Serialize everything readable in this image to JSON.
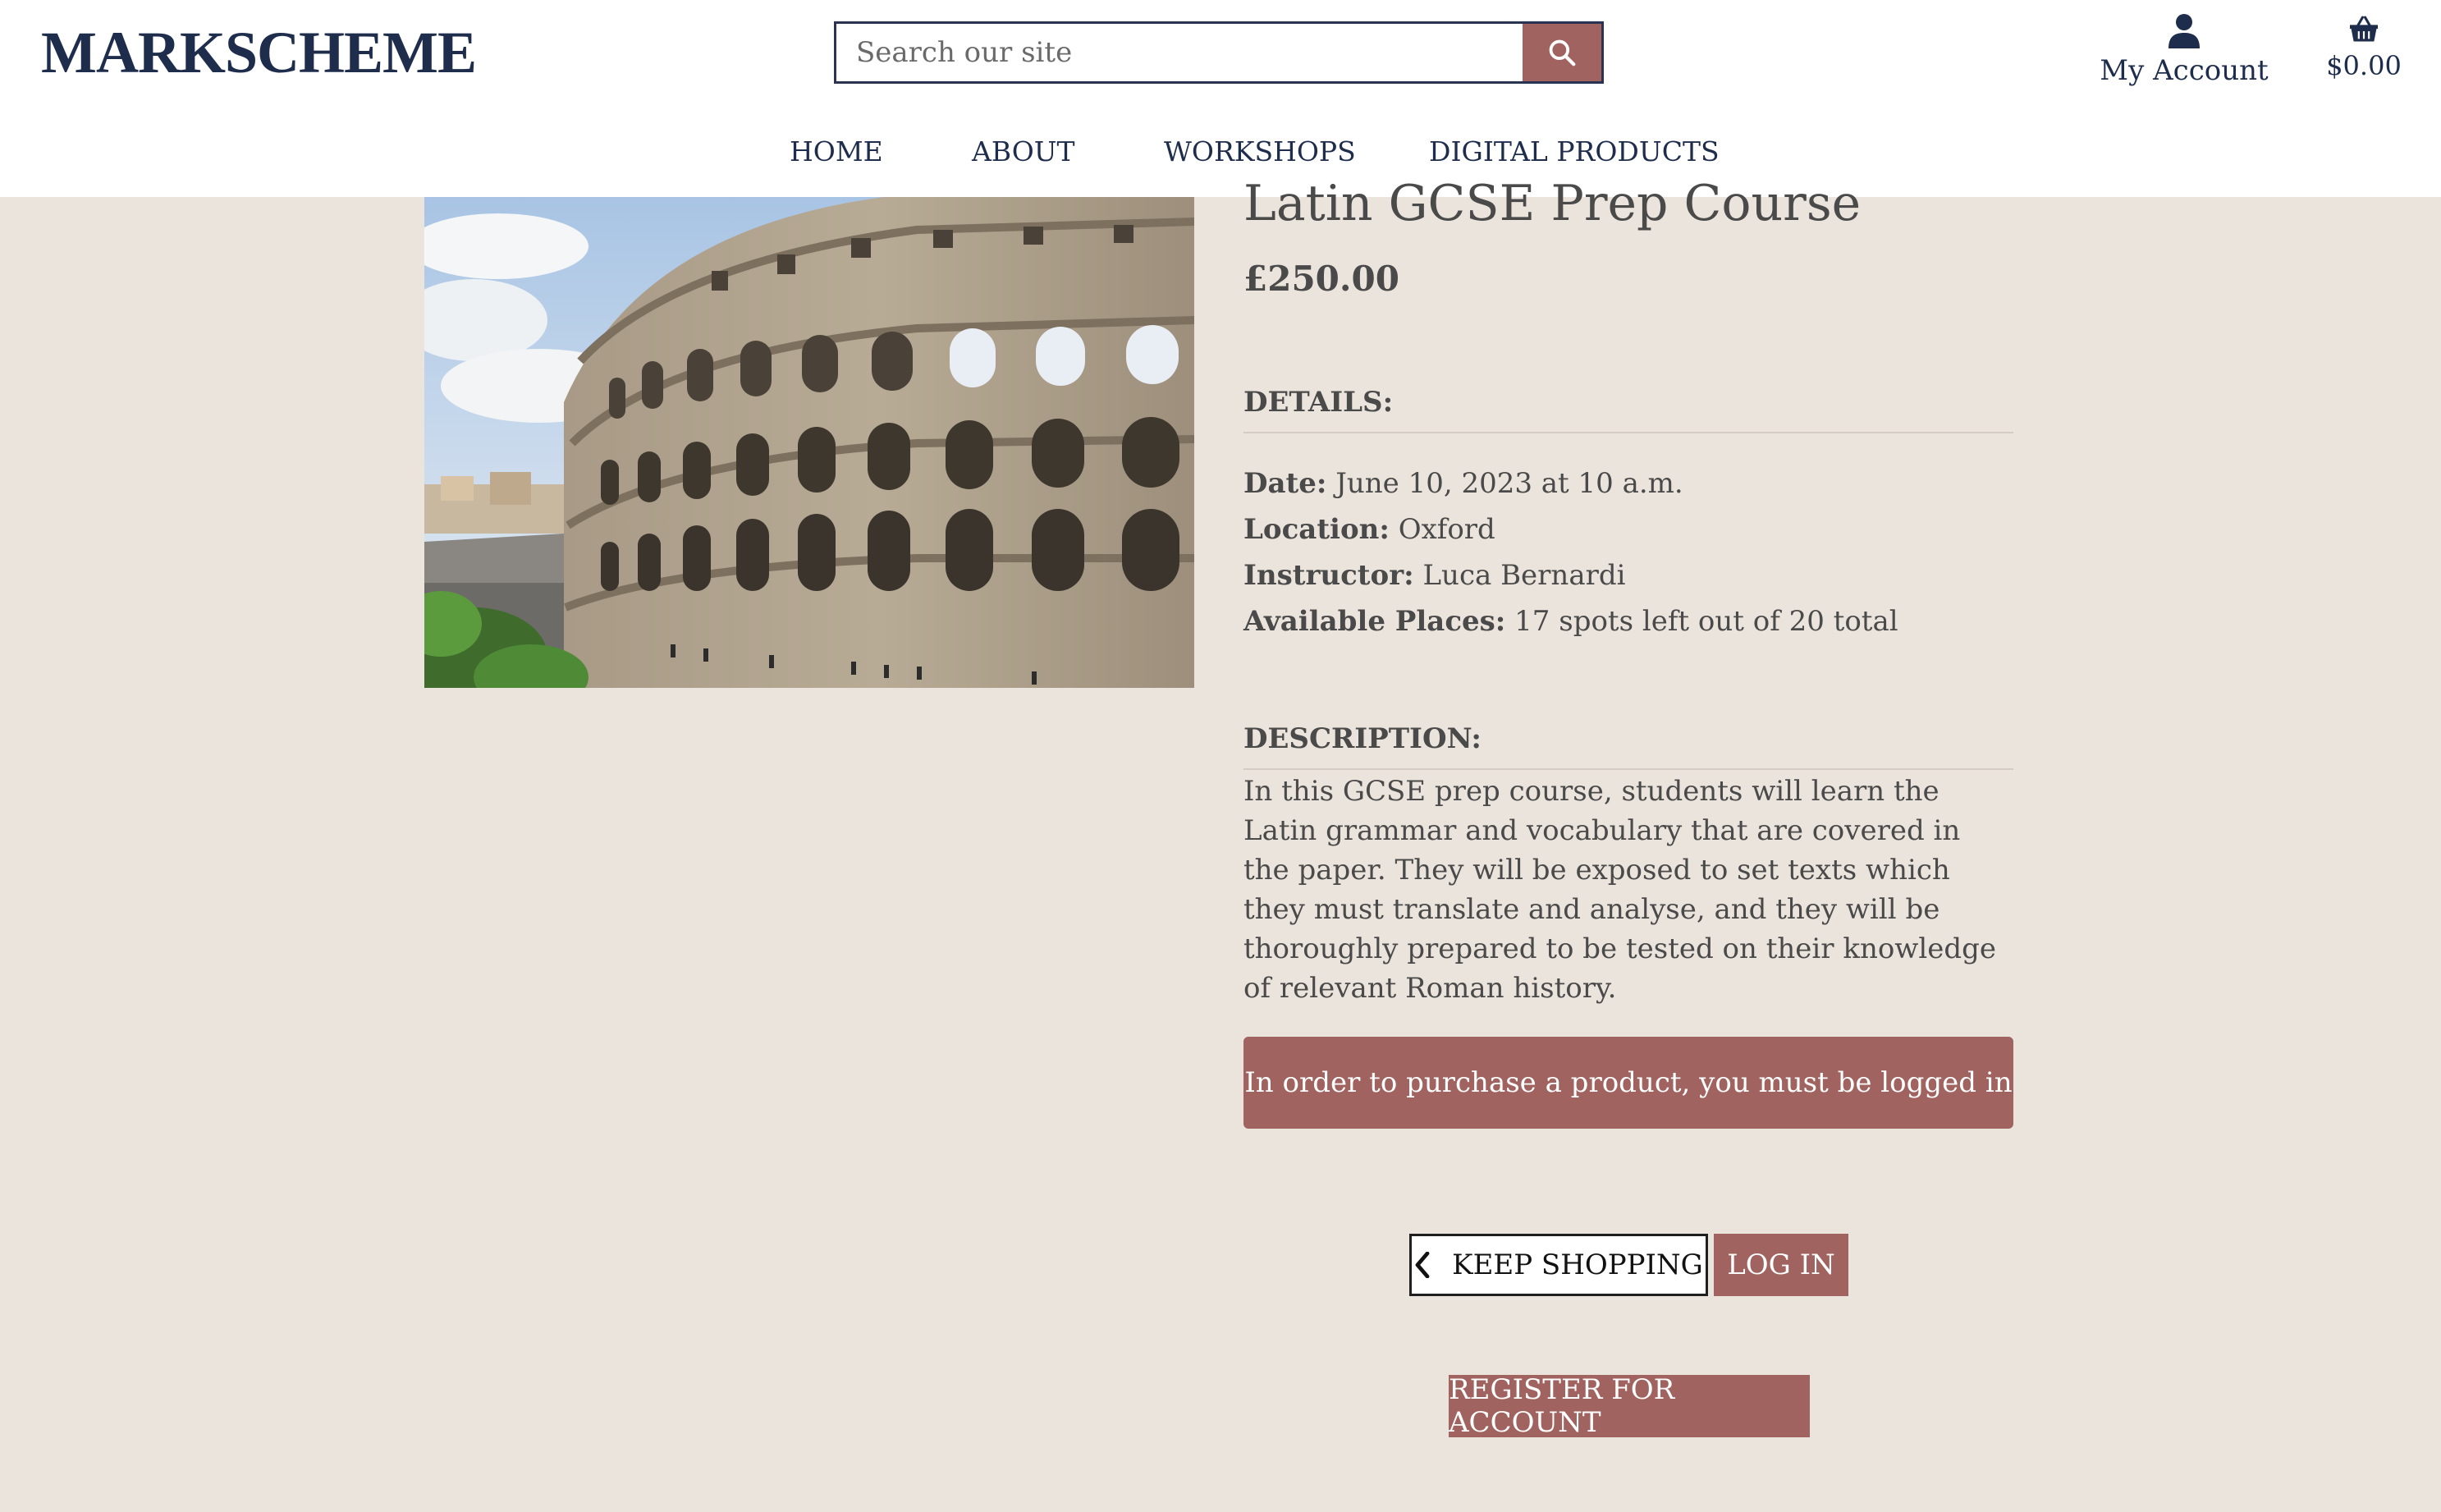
{
  "header": {
    "logo": "MARKSCHEME",
    "search": {
      "placeholder": "Search our site",
      "value": "",
      "icon": "search-icon"
    },
    "account": {
      "label": "My Account",
      "icon": "user-icon"
    },
    "cart": {
      "total": "$0.00",
      "icon": "basket-icon"
    }
  },
  "nav": [
    {
      "label": "HOME"
    },
    {
      "label": "ABOUT"
    },
    {
      "label": "WORKSHOPS"
    },
    {
      "label": "DIGITAL PRODUCTS"
    }
  ],
  "product": {
    "image_subject": "Colosseum, Rome",
    "title": "Latin GCSE Prep Course",
    "price": "£250.00",
    "details_heading": "DETAILS:",
    "details": [
      {
        "label": "Date:",
        "value": "June 10, 2023 at 10 a.m."
      },
      {
        "label": "Location:",
        "value": "Oxford"
      },
      {
        "label": "Instructor:",
        "value": "Luca Bernardi"
      },
      {
        "label": "Available Places:",
        "value": "17 spots left out of 20 total"
      }
    ],
    "description_heading": "DESCRIPTION:",
    "description": "In this GCSE prep course, students will learn the Latin grammar and vocabulary that are covered in the paper. They will be exposed to set texts which they must translate and analyse, and they will be thoroughly prepared to be tested on their knowledge of relevant Roman history."
  },
  "notice": "In order to purchase a product, you must be logged in",
  "actions": {
    "keep_shopping": "KEEP SHOPPING",
    "log_in": "LOG IN",
    "register": "REGISTER FOR ACCOUNT"
  },
  "colors": {
    "accent": "#a0635f",
    "brand": "#1f2d4d",
    "background": "#ebe4dc"
  }
}
